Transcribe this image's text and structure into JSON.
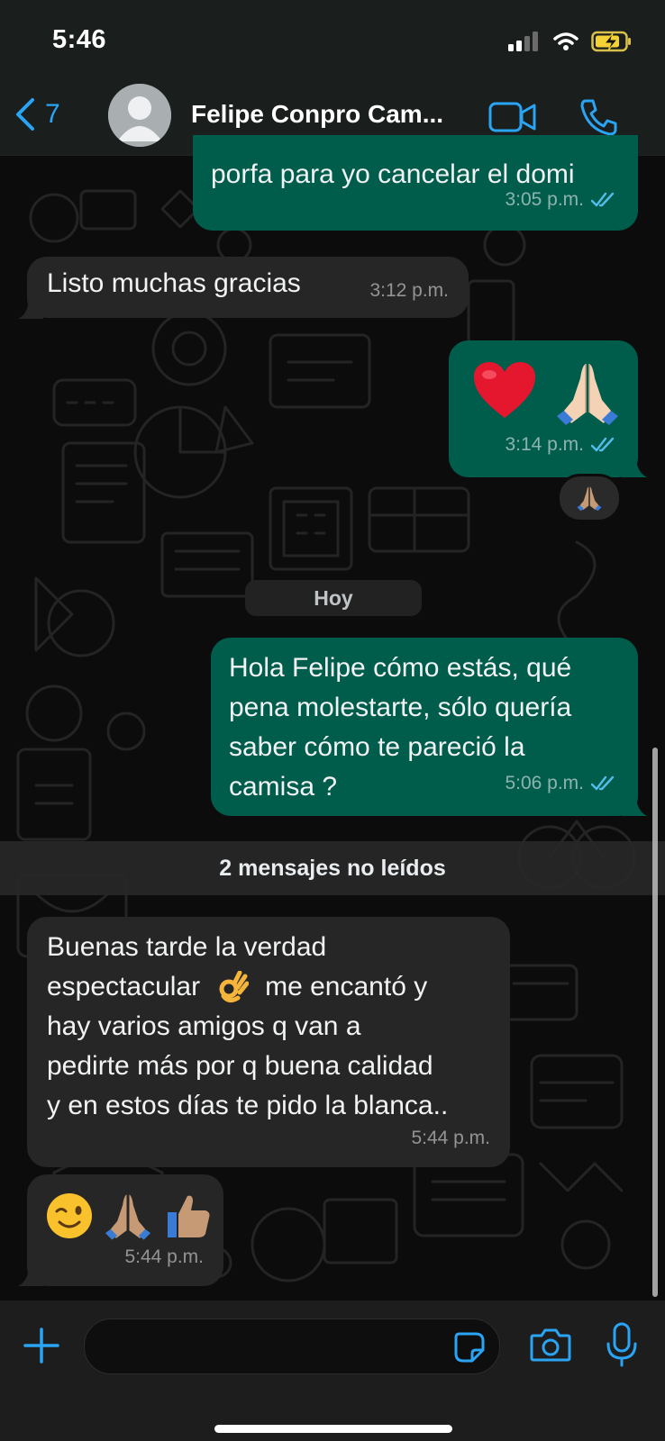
{
  "status_bar": {
    "time": "5:46"
  },
  "header": {
    "back_count": "7",
    "contact_name": "Felipe Conpro Cam..."
  },
  "messages": [
    {
      "direction": "outgoing",
      "text": "porfa para yo cancelar el domi",
      "time": "3:05 p.m.",
      "status": "read"
    },
    {
      "direction": "incoming",
      "text": "Listo muchas gracias",
      "time": "3:12 p.m."
    },
    {
      "direction": "outgoing",
      "emojis": [
        "red-heart",
        "folded-hands-light"
      ],
      "time": "3:14 p.m.",
      "status": "read",
      "reaction": "folded-hands-medium"
    },
    {
      "direction": "outgoing",
      "text": "Hola Felipe cómo estás, qué\npena molestarte, sólo quería\nsaber cómo te pareció la\ncamisa ?",
      "time": "5:06 p.m.",
      "status": "read"
    },
    {
      "direction": "incoming",
      "lines": [
        "Buenas tarde la verdad",
        "espectacular",
        "me encantó y",
        "hay varios amigos q van a",
        "pedirte más por q buena calidad",
        "y en estos días te pido la blanca.."
      ],
      "inline_emoji": "ok-hand",
      "time": "5:44 p.m."
    },
    {
      "direction": "incoming",
      "emojis": [
        "winking-face",
        "folded-hands-medium",
        "thumbs-up-medium"
      ],
      "time": "5:44 p.m."
    }
  ],
  "date_divider": "Hoy",
  "unread_divider": "2 mensajes no leídos",
  "colors": {
    "outgoing_bubble": "#005c4b",
    "incoming_bubble": "#262626",
    "accent": "#2aa4f4",
    "read_tick": "#53bdeb"
  },
  "composer": {
    "placeholder": ""
  }
}
